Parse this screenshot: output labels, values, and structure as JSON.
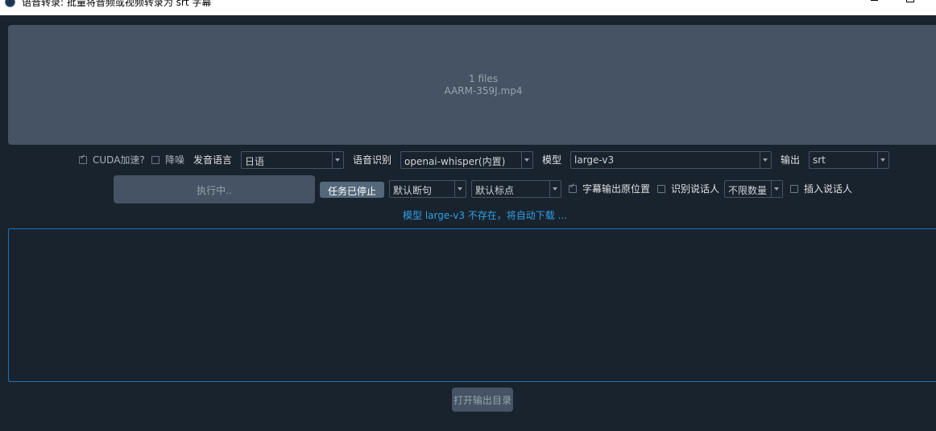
{
  "window": {
    "title": "语音转录: 批量将音频或视频转录为 srt 字幕"
  },
  "dropzone": {
    "file_count": "1 files",
    "file_name": "AARM-359J.mp4"
  },
  "options": {
    "cuda_label": "CUDA加速?",
    "cuda_checked": true,
    "denoise_label": "降噪",
    "denoise_checked": false,
    "language_label": "发音语言",
    "language_value": "日语",
    "asr_label": "语音识别",
    "asr_value": "openai-whisper(内置)",
    "model_label": "模型",
    "model_value": "large-v3",
    "output_label": "输出",
    "output_value": "srt"
  },
  "actions": {
    "run_label": "执行中..",
    "stop_label": "任务已停止",
    "split_value": "默认断句",
    "punct_value": "默认标点",
    "subtitle_pos_label": "字幕输出原位置",
    "subtitle_pos_checked": true,
    "speaker_label": "识别说话人",
    "speaker_checked": false,
    "speaker_count_value": "不限数量",
    "insert_speaker_label": "插入说话人",
    "insert_speaker_checked": false
  },
  "status": {
    "message": "模型 large-v3 不存在，将自动下载 ..."
  },
  "footer": {
    "open_dir_label": "打开输出目录"
  }
}
